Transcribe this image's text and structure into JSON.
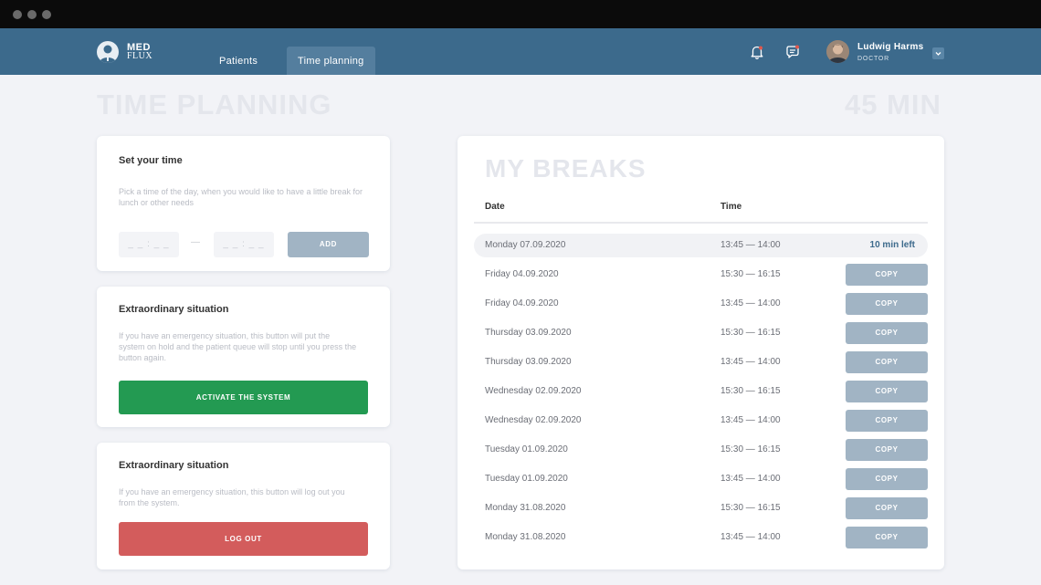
{
  "app": {
    "logo_line1": "MED",
    "logo_line2": "FLUX"
  },
  "nav": {
    "tabs": [
      {
        "label": "Patients",
        "active": false
      },
      {
        "label": "Time planning",
        "active": true
      }
    ],
    "icons": [
      "bell-icon",
      "chat-icon"
    ],
    "user": {
      "name": "Ludwig Harms",
      "role": "DOCTOR"
    }
  },
  "page": {
    "title": "TIME PLANNING",
    "duration": "45 MIN"
  },
  "set_time": {
    "title": "Set your time",
    "description": "Pick a time of the day, when you would like to have a little break for lunch or other needs",
    "from_placeholder": "_ _ : _ _",
    "to_placeholder": "_ _ : _ _",
    "separator": "—",
    "add_label": "ADD"
  },
  "emergency": {
    "title": "Extraordinary situation",
    "description": "If you have an emergency situation, this button will put the system on hold and the patient queue will stop until you press the button again.",
    "button_label": "ACTIVATE THE SYSTEM"
  },
  "logout_card": {
    "title": "Extraordinary situation",
    "description": "If you have an emergency situation, this button will log out you from the system.",
    "button_label": "LOG OUT"
  },
  "breaks": {
    "title": "MY BREAKS",
    "columns": [
      "Date",
      "Time"
    ],
    "rows": [
      {
        "date": "Monday 07.09.2020",
        "time": "13:45 — 14:00",
        "status": "10 min left"
      },
      {
        "date": "Friday 04.09.2020",
        "time": "15:30 — 16:15",
        "action": "COPY"
      },
      {
        "date": "Friday 04.09.2020",
        "time": "13:45 — 14:00",
        "action": "COPY"
      },
      {
        "date": "Thursday 03.09.2020",
        "time": "15:30 — 16:15",
        "action": "COPY"
      },
      {
        "date": "Thursday 03.09.2020",
        "time": "13:45 — 14:00",
        "action": "COPY"
      },
      {
        "date": "Wednesday 02.09.2020",
        "time": "15:30 — 16:15",
        "action": "COPY"
      },
      {
        "date": "Wednesday 02.09.2020",
        "time": "13:45 — 14:00",
        "action": "COPY"
      },
      {
        "date": "Tuesday 01.09.2020",
        "time": "15:30 — 16:15",
        "action": "COPY"
      },
      {
        "date": "Tuesday 01.09.2020",
        "time": "13:45 — 14:00",
        "action": "COPY"
      },
      {
        "date": "Monday 31.08.2020",
        "time": "15:30 — 16:15",
        "action": "COPY"
      },
      {
        "date": "Monday 31.08.2020",
        "time": "13:45 — 14:00",
        "action": "COPY"
      }
    ]
  },
  "colors": {
    "nav": "#3c6a8c",
    "activate": "#239a52",
    "logout": "#d35c5c",
    "copy": "#a1b4c4",
    "add": "#a1b4c4"
  }
}
